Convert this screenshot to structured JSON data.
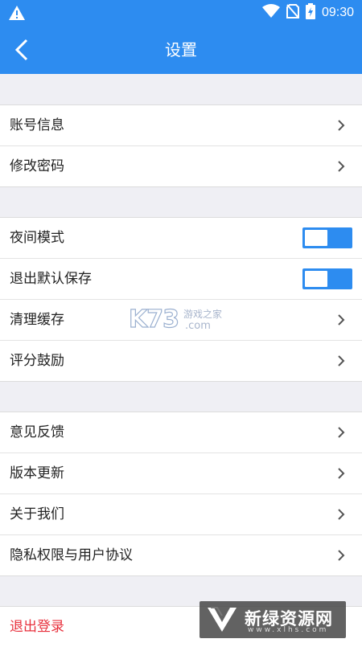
{
  "status_bar": {
    "time": "09:30",
    "warning_icon": "warning-icon",
    "wifi_icon": "wifi-icon",
    "signal_icon": "no-sim-icon",
    "battery_icon": "battery-charging-icon"
  },
  "app_bar": {
    "title": "设置",
    "back_icon": "chevron-left-icon"
  },
  "groups": [
    {
      "items": [
        {
          "label": "账号信息",
          "type": "link"
        },
        {
          "label": "修改密码",
          "type": "link"
        }
      ]
    },
    {
      "items": [
        {
          "label": "夜间模式",
          "type": "toggle",
          "on": false
        },
        {
          "label": "退出默认保存",
          "type": "toggle",
          "on": false
        },
        {
          "label": "清理缓存",
          "type": "link"
        },
        {
          "label": "评分鼓励",
          "type": "link"
        }
      ]
    },
    {
      "items": [
        {
          "label": "意见反馈",
          "type": "link"
        },
        {
          "label": "版本更新",
          "type": "link"
        },
        {
          "label": "关于我们",
          "type": "link"
        },
        {
          "label": "隐私权限与用户协议",
          "type": "link"
        }
      ]
    }
  ],
  "logout": {
    "label": "退出登录"
  },
  "watermarks": {
    "center": {
      "brand": "K73",
      "cn": "游戏之家",
      "domain": ".com"
    },
    "corner": {
      "text": "新绿资源网",
      "url": "www.xlhs.com"
    }
  },
  "colors": {
    "primary": "#2d8cf0",
    "danger": "#e8313d",
    "background": "#efeff4"
  }
}
